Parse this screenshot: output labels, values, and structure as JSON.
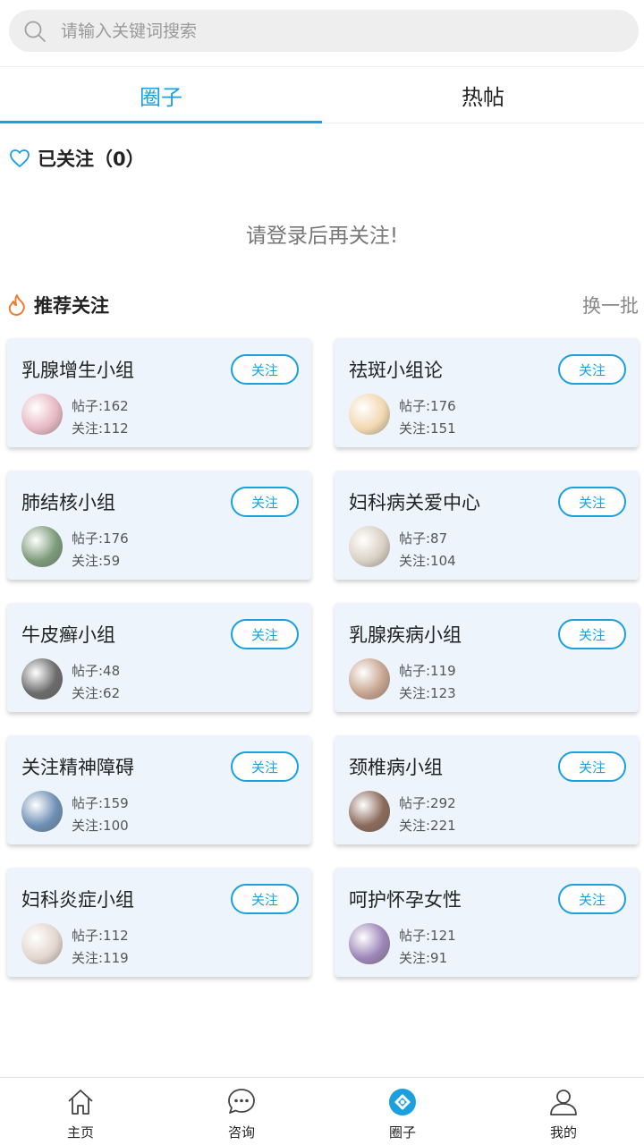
{
  "search": {
    "placeholder": "请输入关键词搜索"
  },
  "tabs": [
    {
      "label": "圈子",
      "active": true
    },
    {
      "label": "热帖",
      "active": false
    }
  ],
  "followed": {
    "title": "已关注（0）",
    "login_tip": "请登录后再关注!"
  },
  "recommend": {
    "title": "推荐关注",
    "swap_label": "换一批"
  },
  "cards": [
    {
      "name": "乳腺增生小组",
      "follow_label": "关注",
      "posts": "帖子:162",
      "fans": "关注:112",
      "avatar_color": "#e7b9c4"
    },
    {
      "name": "祛斑小组论",
      "follow_label": "关注",
      "posts": "帖子:176",
      "fans": "关注:151",
      "avatar_color": "#f1d8b0"
    },
    {
      "name": "肺结核小组",
      "follow_label": "关注",
      "posts": "帖子:176",
      "fans": "关注:59",
      "avatar_color": "#7d9b7a"
    },
    {
      "name": "妇科病关爱中心",
      "follow_label": "关注",
      "posts": "帖子:87",
      "fans": "关注:104",
      "avatar_color": "#d9d0c4"
    },
    {
      "name": "牛皮癣小组",
      "follow_label": "关注",
      "posts": "帖子:48",
      "fans": "关注:62",
      "avatar_color": "#6b6b6b"
    },
    {
      "name": "乳腺疾病小组",
      "follow_label": "关注",
      "posts": "帖子:119",
      "fans": "关注:123",
      "avatar_color": "#c7a48f"
    },
    {
      "name": "关注精神障碍",
      "follow_label": "关注",
      "posts": "帖子:159",
      "fans": "关注:100",
      "avatar_color": "#6e8fb5"
    },
    {
      "name": "颈椎病小组",
      "follow_label": "关注",
      "posts": "帖子:292",
      "fans": "关注:221",
      "avatar_color": "#8a6a5a"
    },
    {
      "name": "妇科炎症小组",
      "follow_label": "关注",
      "posts": "帖子:112",
      "fans": "关注:119",
      "avatar_color": "#e4d6cf"
    },
    {
      "name": "呵护怀孕女性",
      "follow_label": "关注",
      "posts": "帖子:121",
      "fans": "关注:91",
      "avatar_color": "#9d86b8"
    }
  ],
  "nav": [
    {
      "label": "主页",
      "icon": "home-icon"
    },
    {
      "label": "咨询",
      "icon": "chat-icon"
    },
    {
      "label": "圈子",
      "icon": "circle-icon",
      "active": true
    },
    {
      "label": "我的",
      "icon": "user-icon"
    }
  ],
  "colors": {
    "accent": "#1a9fdf",
    "card_bg": "#eef4fb",
    "fire": "#f07a2e"
  }
}
